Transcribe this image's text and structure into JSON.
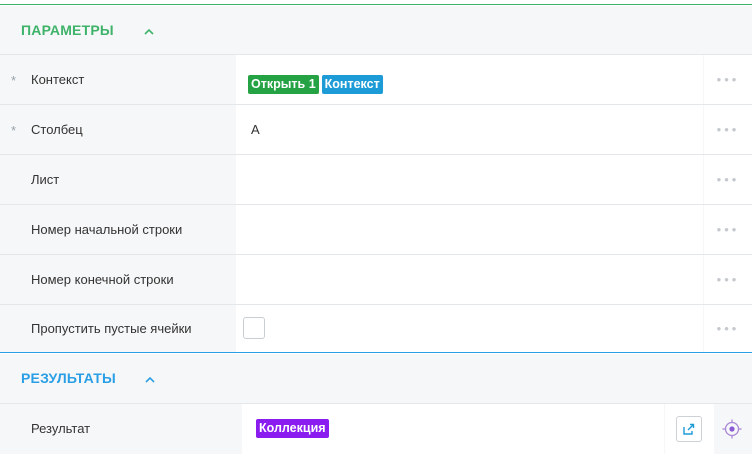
{
  "parameters": {
    "title": "ПАРАМЕТРЫ",
    "collapse_icon": "chevron-up-icon",
    "title_color": "#3fb36a",
    "rows": [
      {
        "label": "Контекст",
        "required": true,
        "required_mark": "*",
        "chips": [
          {
            "text": "Открыть 1",
            "color": "#25a244"
          },
          {
            "text": "Контекст",
            "color": "#1d9bd6"
          }
        ],
        "more": "•••"
      },
      {
        "label": "Столбец",
        "required": true,
        "required_mark": "*",
        "value": "A",
        "more": "•••"
      },
      {
        "label": "Лист",
        "required": false,
        "value": "",
        "more": "•••"
      },
      {
        "label": "Номер начальной строки",
        "required": false,
        "value": "",
        "more": "•••"
      },
      {
        "label": "Номер конечной строки",
        "required": false,
        "value": "",
        "more": "•••"
      },
      {
        "label": "Пропустить пустые ячейки",
        "required": false,
        "checked": false,
        "more": "•••"
      }
    ]
  },
  "results": {
    "title": "РЕЗУЛЬТАТЫ",
    "collapse_icon": "chevron-up-icon",
    "title_color": "#2b9fe6",
    "rows": [
      {
        "label": "Результат",
        "chip": {
          "text": "Коллекция",
          "color": "#8b1cf0"
        },
        "action_icon": "export-icon",
        "extra_icon": "target-icon"
      }
    ]
  }
}
